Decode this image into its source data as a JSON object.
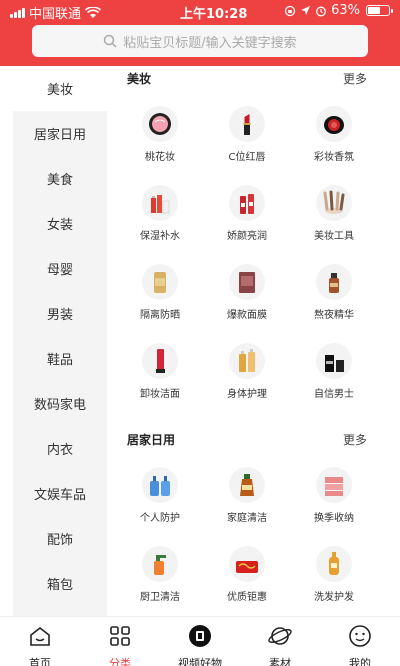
{
  "status": {
    "carrier": "中国联通",
    "time": "上午10:28",
    "battery": "63%",
    "battery_level": 0.63
  },
  "search": {
    "placeholder": "粘贴宝贝标题/输入关键字搜索"
  },
  "sidebar": {
    "items": [
      {
        "label": "美妆"
      },
      {
        "label": "居家日用"
      },
      {
        "label": "美食"
      },
      {
        "label": "女装"
      },
      {
        "label": "母婴"
      },
      {
        "label": "男装"
      },
      {
        "label": "鞋品"
      },
      {
        "label": "数码家电"
      },
      {
        "label": "内衣"
      },
      {
        "label": "文娱车品"
      },
      {
        "label": "配饰"
      },
      {
        "label": "箱包"
      }
    ],
    "active_index": 0
  },
  "sections": [
    {
      "title": "美妆",
      "more": "更多",
      "items": [
        {
          "label": "桃花妆",
          "icon": "compact-powder-icon"
        },
        {
          "label": "C位红唇",
          "icon": "lipstick-icon"
        },
        {
          "label": "彩妆香氛",
          "icon": "blush-compact-icon"
        },
        {
          "label": "保湿补水",
          "icon": "skincare-bottles-icon"
        },
        {
          "label": "娇颜亮润",
          "icon": "lotion-bottles-icon"
        },
        {
          "label": "美妆工具",
          "icon": "makeup-brushes-icon"
        },
        {
          "label": "隔离防晒",
          "icon": "sunscreen-icon"
        },
        {
          "label": "爆款面膜",
          "icon": "face-mask-icon"
        },
        {
          "label": "熬夜精华",
          "icon": "serum-bottle-icon"
        },
        {
          "label": "卸妆洁面",
          "icon": "cleanser-tube-icon"
        },
        {
          "label": "身体护理",
          "icon": "body-lotion-icon"
        },
        {
          "label": "自信男士",
          "icon": "mens-care-icon"
        }
      ]
    },
    {
      "title": "居家日用",
      "more": "更多",
      "items": [
        {
          "label": "个人防护",
          "icon": "hand-sanitizer-icon"
        },
        {
          "label": "家庭清洁",
          "icon": "disinfectant-bottle-icon"
        },
        {
          "label": "换季收纳",
          "icon": "storage-box-icon"
        },
        {
          "label": "厨卫清洁",
          "icon": "spray-cleaner-icon"
        },
        {
          "label": "优质钜惠",
          "icon": "tissue-pack-icon"
        },
        {
          "label": "洗发护发",
          "icon": "shampoo-bottle-icon"
        }
      ]
    }
  ],
  "tabbar": {
    "items": [
      {
        "label": "首页",
        "icon": "home-icon"
      },
      {
        "label": "分类",
        "icon": "category-icon"
      },
      {
        "label": "视频好物",
        "icon": "video-icon"
      },
      {
        "label": "素材",
        "icon": "planet-icon"
      },
      {
        "label": "我的",
        "icon": "profile-icon"
      }
    ],
    "active_index": 1
  },
  "colors": {
    "accent": "#ee4242",
    "sidebar_bg": "#f4f4f4"
  }
}
